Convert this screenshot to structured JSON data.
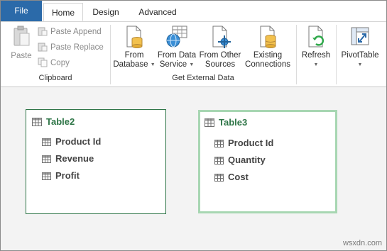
{
  "tabs": [
    {
      "label": "File"
    },
    {
      "label": "Home"
    },
    {
      "label": "Design"
    },
    {
      "label": "Advanced"
    }
  ],
  "clipboard": {
    "paste": "Paste",
    "paste_append": "Paste Append",
    "paste_replace": "Paste Replace",
    "copy": "Copy",
    "group_label": "Clipboard"
  },
  "external_data": {
    "from_database": [
      "From",
      "Database"
    ],
    "from_data_service": [
      "From Data",
      "Service"
    ],
    "from_other_sources": [
      "From Other",
      "Sources"
    ],
    "existing_connections": [
      "Existing",
      "Connections"
    ],
    "group_label": "Get External Data"
  },
  "refresh": {
    "label": "Refresh"
  },
  "pivot": {
    "label": "PivotTable"
  },
  "tables": [
    {
      "name": "Table2",
      "fields": [
        "Product Id",
        "Revenue",
        "Profit"
      ]
    },
    {
      "name": "Table3",
      "fields": [
        "Product Id",
        "Quantity",
        "Cost"
      ]
    }
  ],
  "watermark": "wsxdn.com",
  "colors": {
    "file_tab": "#2b6aa9",
    "table_title": "#2e7547",
    "selected_border": "#a7d6b2"
  }
}
